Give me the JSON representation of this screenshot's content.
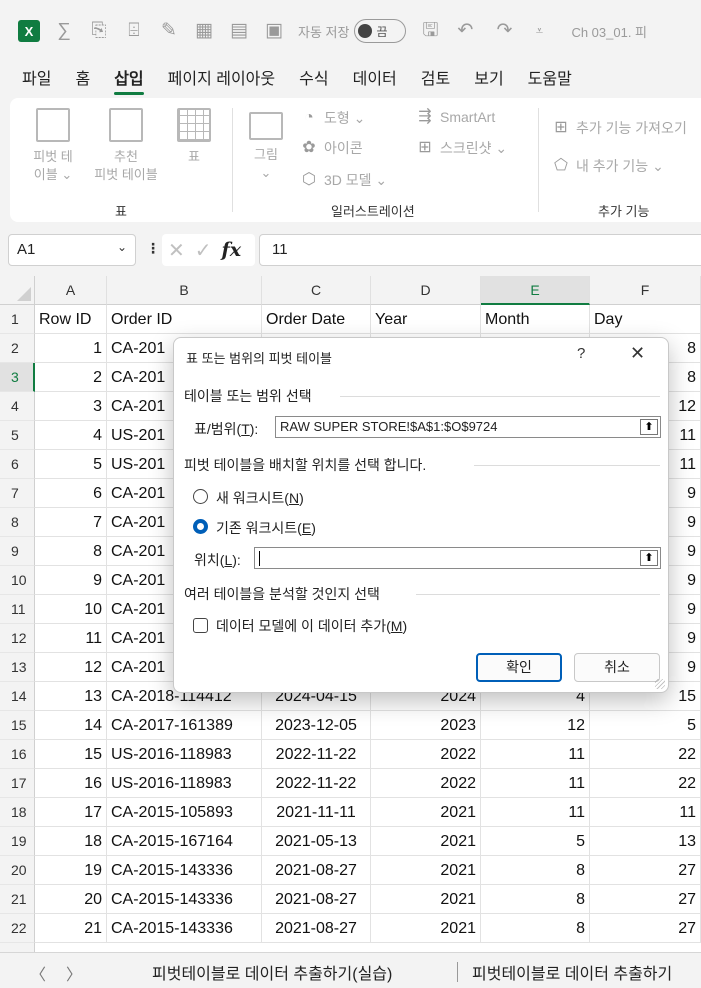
{
  "app": {
    "logo": "X",
    "autosave_label": "자동 저장",
    "autosave_state": "끔",
    "filename": "Ch 03_01. 피",
    "accent_color": "#107c41"
  },
  "menu": {
    "tabs": [
      "파일",
      "홈",
      "삽입",
      "페이지 레이아웃",
      "수식",
      "데이터",
      "검토",
      "보기",
      "도움말"
    ],
    "active": "삽입"
  },
  "ribbon": {
    "pivot_table": "피벗 테\n이블 ⌄",
    "recommended_pivot": "추천\n피벗 테이블",
    "table": "표",
    "picture": "그림\n⌄",
    "shapes": "도형 ⌄",
    "icons": "아이콘",
    "models_3d": "3D 모델 ⌄",
    "smartart": "SmartArt",
    "screenshot": "스크린샷 ⌄",
    "get_addins": "추가 기능 가져오기",
    "my_addins": "내 추가 기능  ⌄",
    "group_table": "표",
    "group_illustrations": "일러스트레이션",
    "group_addins": "추가 기능"
  },
  "formula_bar": {
    "name_box": "A1",
    "fx": "fx",
    "content": "11"
  },
  "grid": {
    "columns": [
      "A",
      "B",
      "C",
      "D",
      "E",
      "F"
    ],
    "selected_col": "E",
    "selected_row": "3",
    "header_row": [
      "Row ID",
      "Order ID",
      "Order Date",
      "Year",
      "Month",
      "Day"
    ],
    "rows": [
      {
        "n": "2",
        "a": "1",
        "b": "CA-201",
        "c": "",
        "d": "",
        "e": "",
        "f": "8"
      },
      {
        "n": "3",
        "a": "2",
        "b": "CA-201",
        "c": "",
        "d": "",
        "e": "",
        "f": "8"
      },
      {
        "n": "4",
        "a": "3",
        "b": "CA-201",
        "c": "",
        "d": "",
        "e": "",
        "f": "12"
      },
      {
        "n": "5",
        "a": "4",
        "b": "US-201",
        "c": "",
        "d": "",
        "e": "",
        "f": "11"
      },
      {
        "n": "6",
        "a": "5",
        "b": "US-201",
        "c": "",
        "d": "",
        "e": "",
        "f": "11"
      },
      {
        "n": "7",
        "a": "6",
        "b": "CA-201",
        "c": "",
        "d": "",
        "e": "",
        "f": "9"
      },
      {
        "n": "8",
        "a": "7",
        "b": "CA-201",
        "c": "",
        "d": "",
        "e": "",
        "f": "9"
      },
      {
        "n": "9",
        "a": "8",
        "b": "CA-201",
        "c": "",
        "d": "",
        "e": "",
        "f": "9"
      },
      {
        "n": "10",
        "a": "9",
        "b": "CA-201",
        "c": "",
        "d": "",
        "e": "",
        "f": "9"
      },
      {
        "n": "11",
        "a": "10",
        "b": "CA-201",
        "c": "",
        "d": "",
        "e": "",
        "f": "9"
      },
      {
        "n": "12",
        "a": "11",
        "b": "CA-201",
        "c": "",
        "d": "",
        "e": "",
        "f": "9"
      },
      {
        "n": "13",
        "a": "12",
        "b": "CA-201",
        "c": "",
        "d": "",
        "e": "",
        "f": "9"
      },
      {
        "n": "14",
        "a": "13",
        "b": "CA-2018-114412",
        "c": "2024-04-15",
        "d": "2024",
        "e": "4",
        "f": "15"
      },
      {
        "n": "15",
        "a": "14",
        "b": "CA-2017-161389",
        "c": "2023-12-05",
        "d": "2023",
        "e": "12",
        "f": "5"
      },
      {
        "n": "16",
        "a": "15",
        "b": "US-2016-118983",
        "c": "2022-11-22",
        "d": "2022",
        "e": "11",
        "f": "22"
      },
      {
        "n": "17",
        "a": "16",
        "b": "US-2016-118983",
        "c": "2022-11-22",
        "d": "2022",
        "e": "11",
        "f": "22"
      },
      {
        "n": "18",
        "a": "17",
        "b": "CA-2015-105893",
        "c": "2021-11-11",
        "d": "2021",
        "e": "11",
        "f": "11"
      },
      {
        "n": "19",
        "a": "18",
        "b": "CA-2015-167164",
        "c": "2021-05-13",
        "d": "2021",
        "e": "5",
        "f": "13"
      },
      {
        "n": "20",
        "a": "19",
        "b": "CA-2015-143336",
        "c": "2021-08-27",
        "d": "2021",
        "e": "8",
        "f": "27"
      },
      {
        "n": "21",
        "a": "20",
        "b": "CA-2015-143336",
        "c": "2021-08-27",
        "d": "2021",
        "e": "8",
        "f": "27"
      },
      {
        "n": "22",
        "a": "21",
        "b": "CA-2015-143336",
        "c": "2021-08-27",
        "d": "2021",
        "e": "8",
        "f": "27"
      }
    ]
  },
  "sheets": {
    "tabs": [
      "피벗테이블로 데이터 추출하기(실습)",
      "피벗테이블로 데이터 추출하기"
    ]
  },
  "dialog": {
    "title": "표 또는 범위의 피벗 테이블",
    "help": "?",
    "close": "✕",
    "section_select": "테이블 또는 범위 선택",
    "range_label": "표/범위(",
    "range_key": "T",
    "range_label_end": "):",
    "range_value": "RAW SUPER STORE!$A$1:$O$9724",
    "section_place": "피벗 테이블을 배치할 위치를 선택 합니다.",
    "new_sheet": "새 워크시트(",
    "new_sheet_key": "N",
    "existing_sheet": "기존 워크시트(",
    "existing_sheet_key": "E",
    "location_label": "위치(",
    "location_key": "L",
    "location_value": "",
    "section_multi": "여러 테이블을 분석할 것인지 선택",
    "add_model": "데이터 모델에 이 데이터 추가(",
    "add_model_key": "M",
    "ok": "확인",
    "cancel": "취소",
    "close_paren": ")"
  }
}
